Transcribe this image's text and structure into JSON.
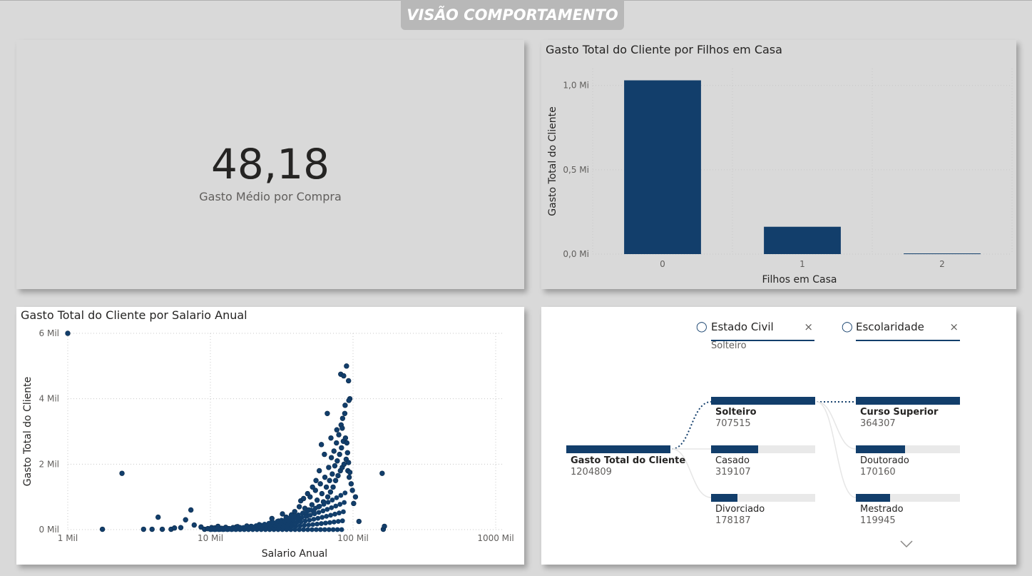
{
  "page": {
    "title": "VISÃO COMPORTAMENTO"
  },
  "kpi": {
    "value": "48,18",
    "label": "Gasto Médio por Compra"
  },
  "bar_chart_title": "Gasto Total do Cliente por Filhos em Casa",
  "scatter_chart_title": "Gasto Total do Cliente por Salario Anual",
  "chart_data": [
    {
      "type": "bar",
      "title": "Gasto Total do Cliente por Filhos em Casa",
      "xlabel": "Filhos em Casa",
      "ylabel": "Gasto Total do Cliente",
      "categories": [
        "0",
        "1",
        "2"
      ],
      "values": [
        1030000,
        162000,
        4000
      ],
      "ylim": [
        0,
        1100000
      ],
      "yticks": [
        {
          "v": 0,
          "label": "0,0 Mi"
        },
        {
          "v": 500000,
          "label": "0,5 Mi"
        },
        {
          "v": 1000000,
          "label": "1,0 Mi"
        }
      ],
      "color": "#123e6b",
      "grid": true
    },
    {
      "type": "scatter",
      "title": "Gasto Total do Cliente por Salario Anual",
      "xlabel": "Salario Anual",
      "ylabel": "Gasto Total do Cliente",
      "xscale": "log",
      "xlim": [
        1000,
        1000000
      ],
      "ylim": [
        0,
        6000
      ],
      "xticks": [
        {
          "v": 1000,
          "label": "1 Mil"
        },
        {
          "v": 10000,
          "label": "10 Mil"
        },
        {
          "v": 100000,
          "label": "100 Mil"
        },
        {
          "v": 1000000,
          "label": "1000 Mil"
        }
      ],
      "yticks": [
        {
          "v": 0,
          "label": "0 Mil"
        },
        {
          "v": 2000,
          "label": "2 Mil"
        },
        {
          "v": 4000,
          "label": "4 Mil"
        },
        {
          "v": 6000,
          "label": "6 Mil"
        }
      ],
      "color": "#123e6b",
      "grid": true,
      "points": [
        [
          1000,
          6000
        ],
        [
          1750,
          10
        ],
        [
          2400,
          1720
        ],
        [
          3400,
          10
        ],
        [
          3900,
          10
        ],
        [
          4300,
          380
        ],
        [
          4600,
          10
        ],
        [
          5300,
          10
        ],
        [
          5600,
          50
        ],
        [
          6200,
          60
        ],
        [
          6700,
          300
        ],
        [
          7300,
          600
        ],
        [
          7700,
          140
        ],
        [
          8600,
          80
        ],
        [
          9100,
          10
        ],
        [
          9600,
          30
        ],
        [
          10200,
          60
        ],
        [
          10700,
          50
        ],
        [
          11300,
          100
        ],
        [
          12000,
          40
        ],
        [
          12800,
          70
        ],
        [
          13500,
          30
        ],
        [
          14400,
          60
        ],
        [
          15200,
          80
        ],
        [
          16100,
          60
        ],
        [
          17000,
          50
        ],
        [
          18200,
          70
        ],
        [
          19300,
          100
        ],
        [
          20500,
          60
        ],
        [
          21700,
          80
        ],
        [
          23000,
          120
        ],
        [
          24500,
          90
        ],
        [
          26000,
          130
        ],
        [
          27000,
          340
        ],
        [
          28000,
          110
        ],
        [
          29500,
          200
        ],
        [
          31000,
          150
        ],
        [
          32000,
          480
        ],
        [
          33500,
          220
        ],
        [
          35000,
          180
        ],
        [
          36500,
          300
        ],
        [
          38000,
          260
        ],
        [
          40000,
          400
        ],
        [
          41500,
          320
        ],
        [
          43000,
          880
        ],
        [
          44500,
          500
        ],
        [
          46000,
          650
        ],
        [
          47500,
          420
        ],
        [
          49000,
          600
        ],
        [
          50000,
          1000
        ],
        [
          51500,
          760
        ],
        [
          53000,
          550
        ],
        [
          54500,
          1200
        ],
        [
          56000,
          900
        ],
        [
          57500,
          700
        ],
        [
          59000,
          1400
        ],
        [
          60500,
          1100
        ],
        [
          62000,
          850
        ],
        [
          63500,
          1600
        ],
        [
          65000,
          1300
        ],
        [
          66500,
          1000
        ],
        [
          67500,
          1900
        ],
        [
          68500,
          1500
        ],
        [
          69500,
          1150
        ],
        [
          70500,
          2200
        ],
        [
          71500,
          1700
        ],
        [
          72500,
          1300
        ],
        [
          73500,
          2400
        ],
        [
          74500,
          1950
        ],
        [
          75500,
          1500
        ],
        [
          76500,
          2650
        ],
        [
          77500,
          2100
        ],
        [
          78500,
          1650
        ],
        [
          79500,
          2900
        ],
        [
          80500,
          2300
        ],
        [
          81500,
          1800
        ],
        [
          82500,
          3200
        ],
        [
          83000,
          2500
        ],
        [
          84000,
          1900
        ],
        [
          84500,
          3400
        ],
        [
          85500,
          2700
        ],
        [
          86500,
          2000
        ],
        [
          87500,
          3550
        ],
        [
          88500,
          2800
        ],
        [
          89500,
          2150
        ],
        [
          90500,
          2650
        ],
        [
          91500,
          2350
        ],
        [
          92000,
          1800
        ],
        [
          93000,
          2050
        ],
        [
          94000,
          1600
        ],
        [
          95000,
          1750
        ],
        [
          97000,
          1400
        ],
        [
          99000,
          1200
        ],
        [
          101000,
          800
        ],
        [
          104000,
          1000
        ],
        [
          110000,
          250
        ],
        [
          160000,
          1720
        ],
        [
          163000,
          10
        ],
        [
          166000,
          100
        ],
        [
          82000,
          4750
        ],
        [
          86000,
          4700
        ],
        [
          90000,
          5000
        ],
        [
          93000,
          4550
        ],
        [
          88000,
          3800
        ],
        [
          95000,
          4000
        ],
        [
          93500,
          3950
        ],
        [
          66000,
          3550
        ],
        [
          77000,
          3050
        ],
        [
          84000,
          3100
        ],
        [
          60000,
          2600
        ],
        [
          70000,
          2800
        ],
        [
          63000,
          2300
        ],
        [
          58000,
          1800
        ],
        [
          55000,
          1500
        ],
        [
          52000,
          1300
        ],
        [
          48000,
          1100
        ],
        [
          45000,
          950
        ],
        [
          42000,
          700
        ],
        [
          39000,
          550
        ],
        [
          37000,
          450
        ],
        [
          34000,
          380
        ],
        [
          30000,
          260
        ],
        [
          26500,
          200
        ],
        [
          22000,
          150
        ],
        [
          18000,
          110
        ],
        [
          15500,
          90
        ]
      ]
    }
  ],
  "decomp": {
    "headers": [
      {
        "label": "Estado Civil",
        "subtitle": "Solteiro",
        "icon": "lightbulb-icon",
        "close": "×"
      },
      {
        "label": "Escolaridade",
        "subtitle": "",
        "icon": "lightbulb-icon",
        "close": "×"
      }
    ],
    "root": {
      "label": "Gasto Total do Cliente",
      "value": "1204809",
      "fraction": 1.0
    },
    "level1": [
      {
        "label": "Solteiro",
        "value": "707515",
        "fraction": 1.0,
        "selected": true
      },
      {
        "label": "Casado",
        "value": "319107",
        "fraction": 0.45,
        "selected": false
      },
      {
        "label": "Divorciado",
        "value": "178187",
        "fraction": 0.25,
        "selected": false
      }
    ],
    "level2": [
      {
        "label": "Curso Superior",
        "value": "364307",
        "fraction": 1.0,
        "selected": true
      },
      {
        "label": "Doutorado",
        "value": "170160",
        "fraction": 0.47,
        "selected": false
      },
      {
        "label": "Mestrado",
        "value": "119945",
        "fraction": 0.33,
        "selected": false
      }
    ],
    "more_icon": "chevron-down-icon"
  }
}
